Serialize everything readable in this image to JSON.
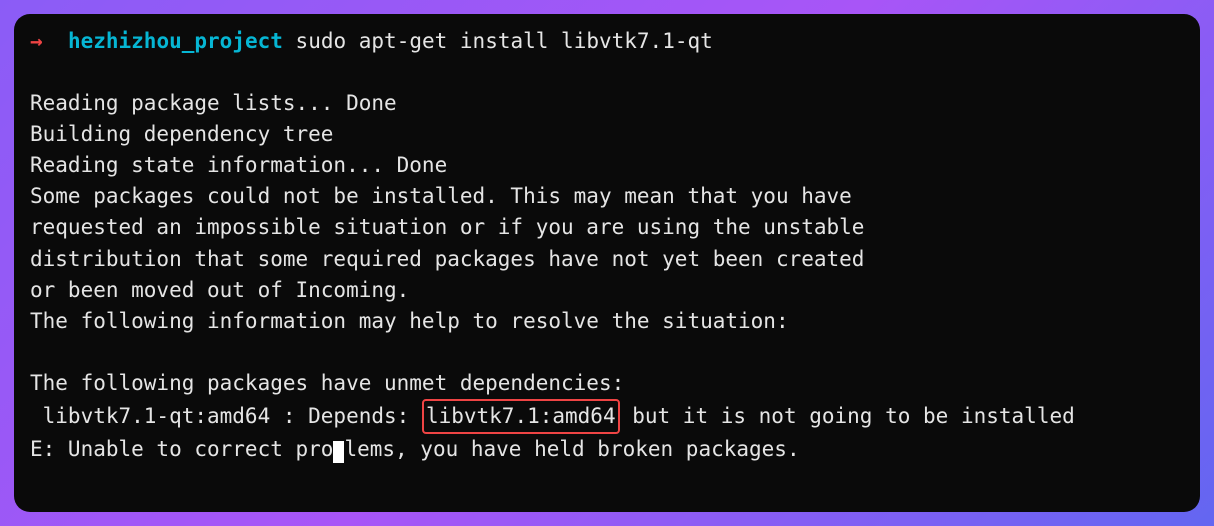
{
  "prompt": {
    "arrow": "→",
    "dir": "hezhizhou_project",
    "cmd": "sudo apt-get install libvtk7.1-qt"
  },
  "out": {
    "l1": "Reading package lists... Done",
    "l2": "Building dependency tree",
    "l3": "Reading state information... Done",
    "l4": "Some packages could not be installed. This may mean that you have",
    "l5": "requested an impossible situation or if you are using the unstable",
    "l6": "distribution that some required packages have not yet been created",
    "l7": "or been moved out of Incoming.",
    "l8": "The following information may help to resolve the situation:",
    "l9": "The following packages have unmet dependencies:",
    "l10_pre": " libvtk7.1-qt:amd64 : Depends: ",
    "l10_hl": "libvtk7.1:amd64",
    "l10_post": " but it is not going to be installed",
    "l11_pre": "E: Unable to correct pro",
    "l11_post": "lems, you have held broken packages."
  }
}
